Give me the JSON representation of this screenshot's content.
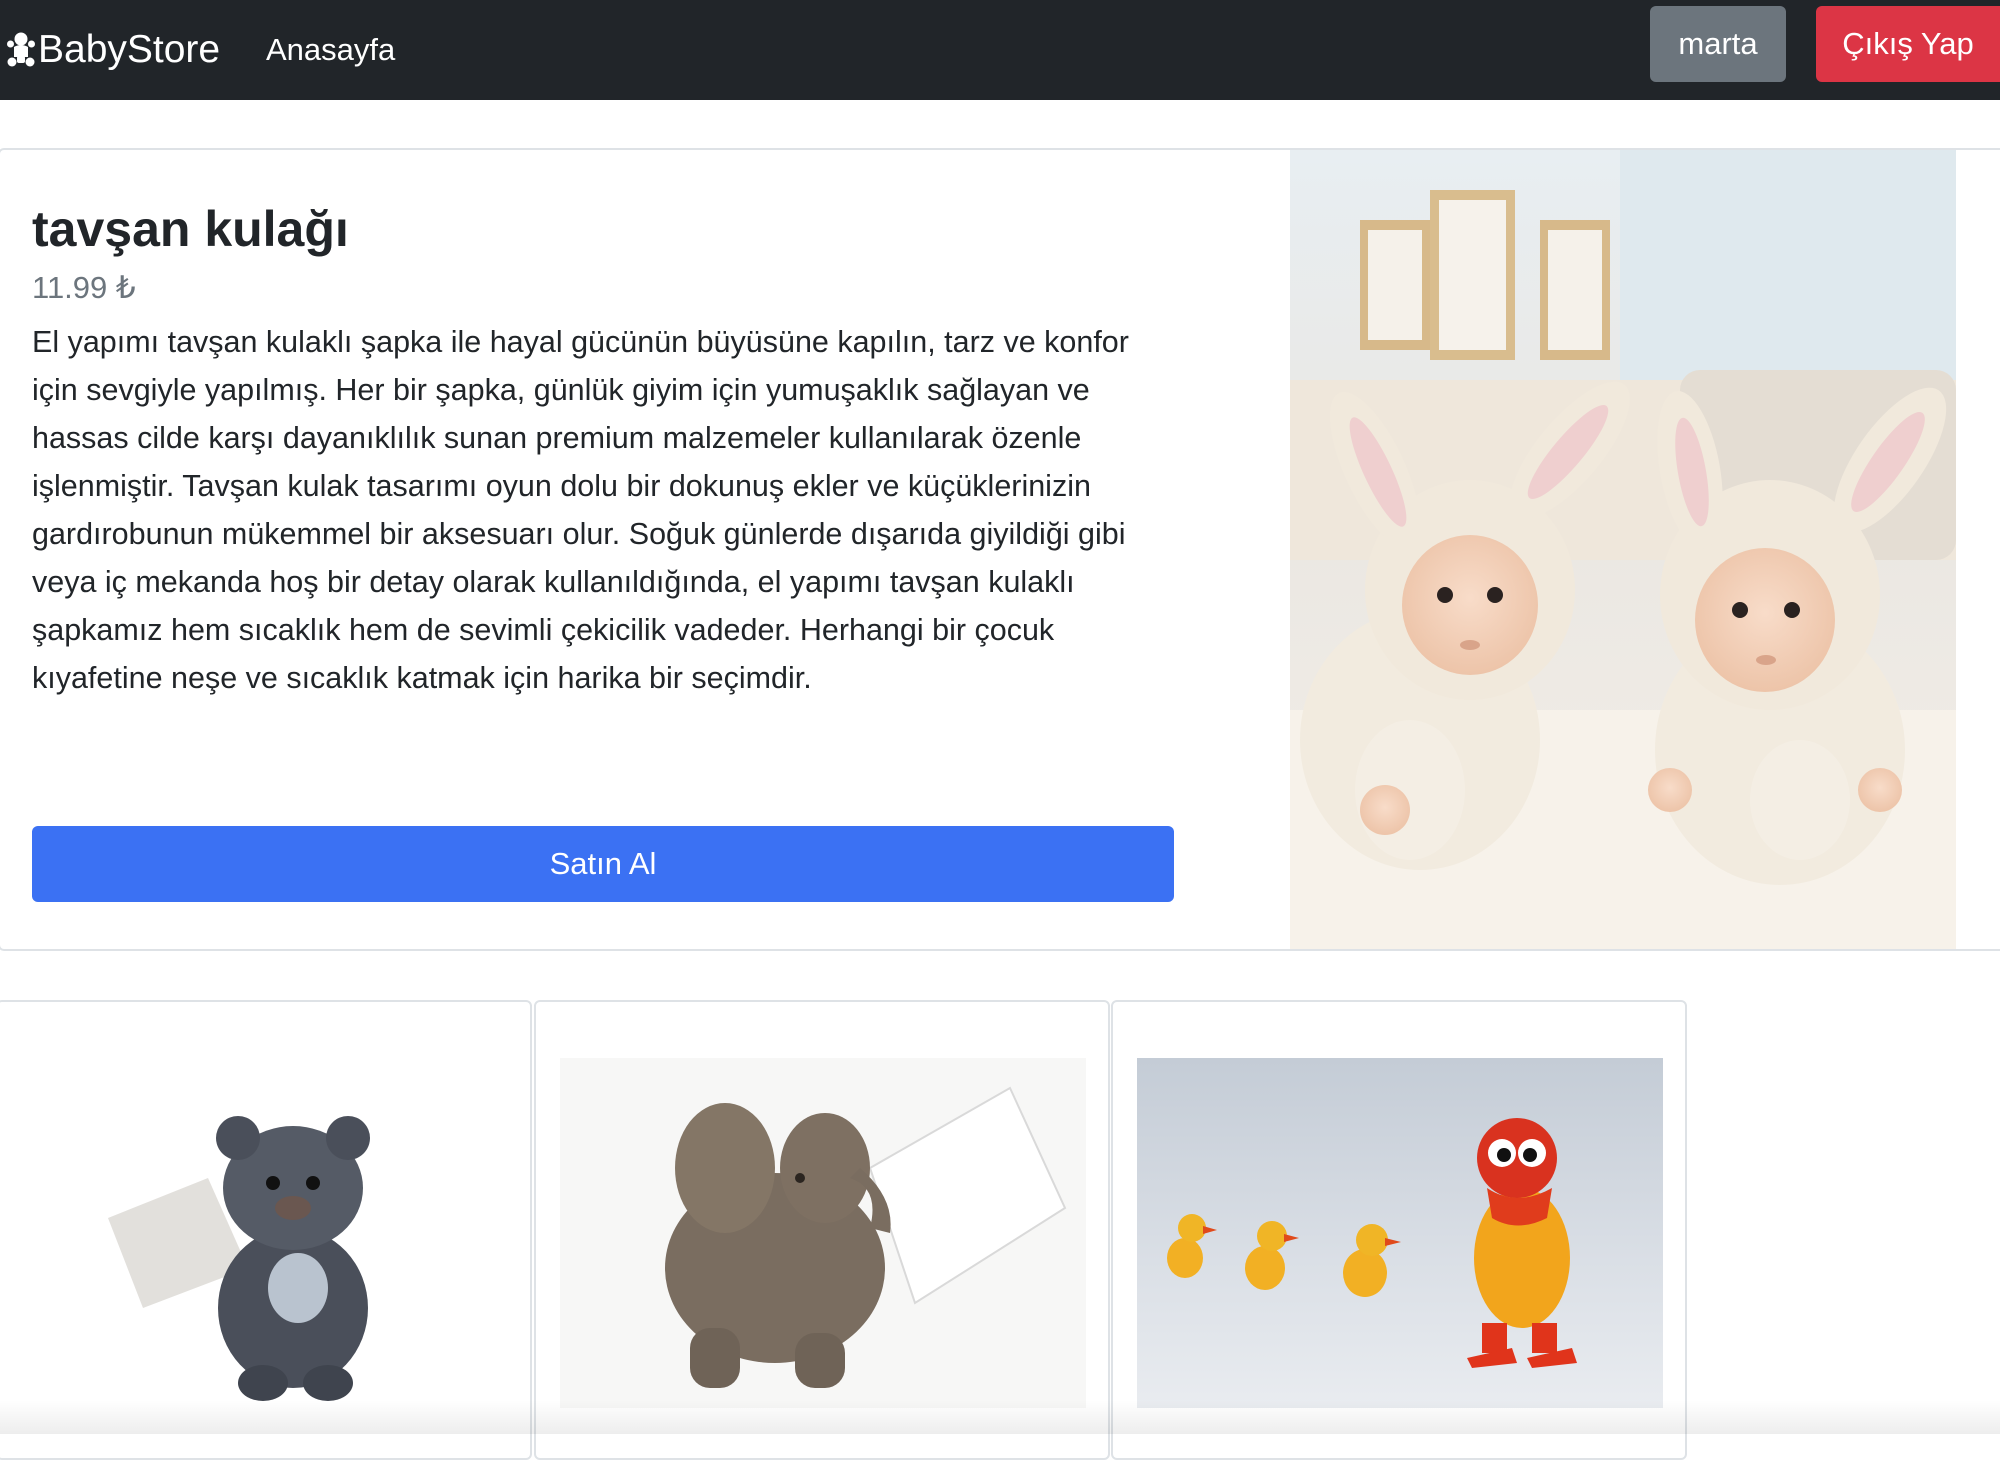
{
  "navbar": {
    "brand": "BabyStore",
    "brand_icon": "baby-icon",
    "home_link": "Anasayfa",
    "user_button": "marta",
    "logout_button": "Çıkış Yap"
  },
  "featured": {
    "title": "tavşan kulağı",
    "price": "11.99 ₺",
    "description": "El yapımı tavşan kulaklı şapka ile hayal gücünün büyüsüne kapılın, tarz ve konfor için sevgiyle yapılmış. Her bir şapka, günlük giyim için yumuşaklık sağlayan ve hassas cilde karşı dayanıklılık sunan premium malzemeler kullanılarak özenle işlenmiştir. Tavşan kulak tasarımı oyun dolu bir dokunuş ekler ve küçüklerinizin gardırobunun mükemmel bir aksesuarı olur. Soğuk günlerde dışarıda giyildiği gibi veya iç mekanda hoş bir detay olarak kullanıldığında, el yapımı tavşan kulaklı şapkamız hem sıcaklık hem de sevimli çekicilik vadeder. Herhangi bir çocuk kıyafetine neşe ve sıcaklık katmak için harika bir seçimdir.",
    "buy_button": "Satın Al",
    "image": "twin-babies-in-bunny-hats-photo"
  },
  "products": [
    {
      "image": "teddy-bear-with-card-photo"
    },
    {
      "image": "felt-elephant-with-card-photo"
    },
    {
      "image": "wind-up-toy-ducks-photo"
    }
  ],
  "colors": {
    "navbar_bg": "#212529",
    "user_button_bg": "#6c757d",
    "logout_button_bg": "#dc3545",
    "buy_button_bg": "#3b71f3",
    "price_text": "#6c757d"
  }
}
